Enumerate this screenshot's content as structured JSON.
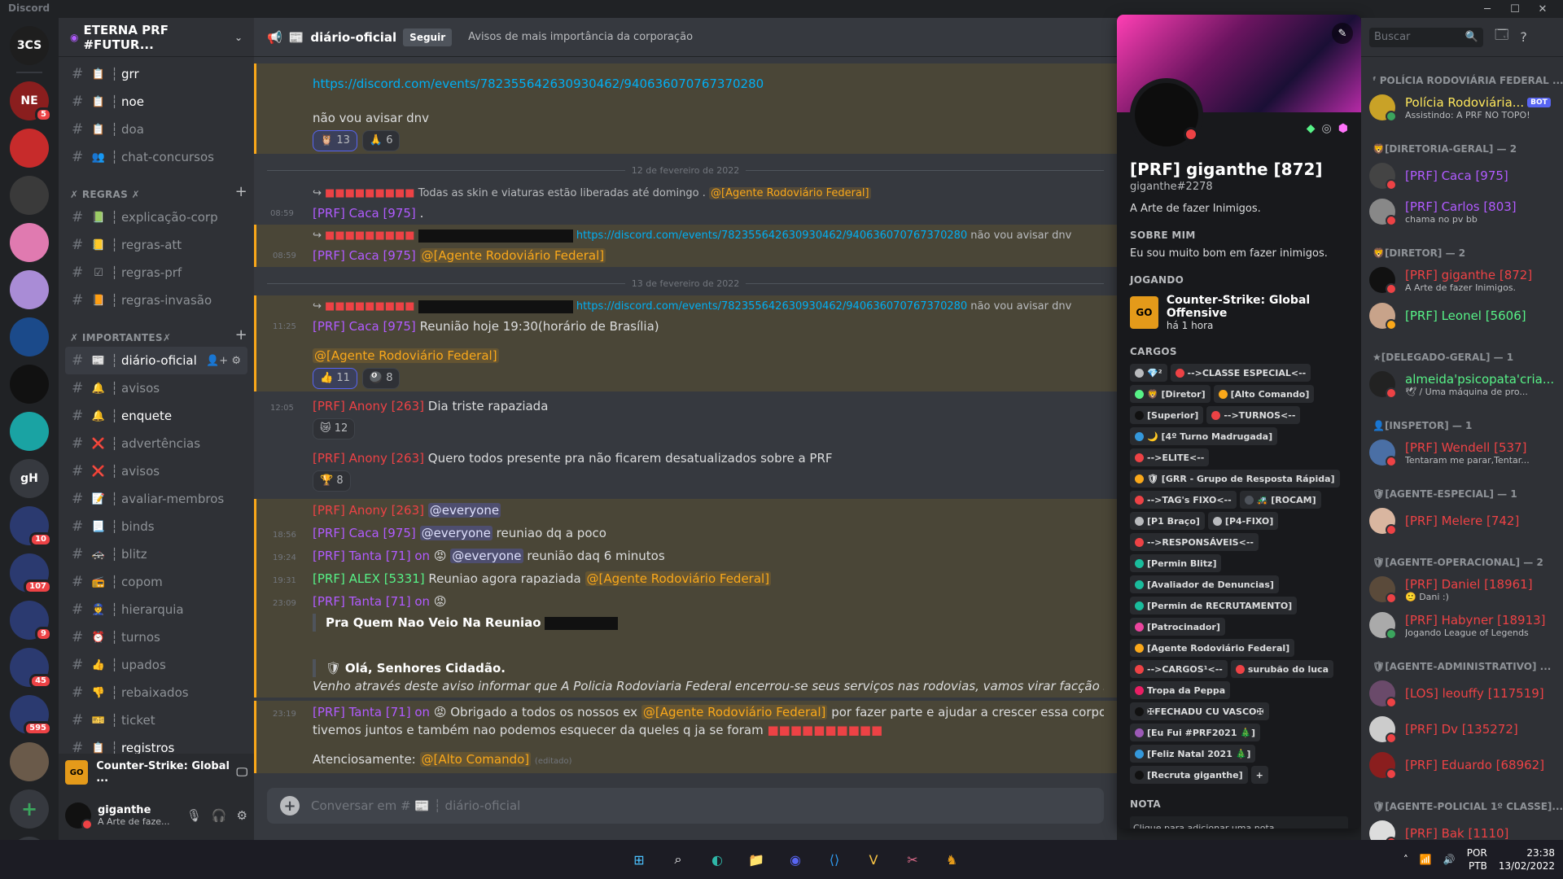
{
  "app": {
    "title": "Discord"
  },
  "server": {
    "name": "ETERNA PRF #FUTUR...",
    "header_icon": "chevron-down-icon"
  },
  "guilds": [
    {
      "label": "3CS",
      "color": "#1e1e1e",
      "badge": ""
    },
    {
      "label": "NE",
      "color": "#8a1e1e",
      "badge": "5"
    },
    {
      "label": "",
      "color": "#c72b2b",
      "badge": ""
    },
    {
      "label": "",
      "color": "#3a3a3a",
      "badge": ""
    },
    {
      "label": "",
      "color": "#e07ab0",
      "badge": ""
    },
    {
      "label": "",
      "color": "#a98cd6",
      "badge": ""
    },
    {
      "label": "",
      "color": "#1b4a8a",
      "badge": ""
    },
    {
      "label": "",
      "color": "#111",
      "badge": ""
    },
    {
      "label": "",
      "color": "#1aa3a3",
      "badge": ""
    },
    {
      "label": "gH",
      "color": "#36393f",
      "badge": ""
    },
    {
      "label": "",
      "color": "#2b3a70",
      "badge": "10"
    },
    {
      "label": "",
      "color": "#2b3a70",
      "badge": "107"
    },
    {
      "label": "",
      "color": "#2b3a70",
      "badge": "9"
    },
    {
      "label": "",
      "color": "#2b3a70",
      "badge": "45"
    },
    {
      "label": "",
      "color": "#2b3a70",
      "badge": "595"
    },
    {
      "label": "",
      "color": "#6a5a4a",
      "badge": ""
    }
  ],
  "channels": {
    "top": [
      {
        "name": "grr",
        "icon": "📋",
        "unread": true
      },
      {
        "name": "noe",
        "icon": "📋",
        "unread": true
      },
      {
        "name": "doa",
        "icon": "📋",
        "unread": false
      },
      {
        "name": "chat-concursos",
        "icon": "👥",
        "unread": false
      }
    ],
    "cat_regras": "✗ REGRAS ✗",
    "regras": [
      {
        "name": "explicação-corp",
        "icon": "📗"
      },
      {
        "name": "regras-att",
        "icon": "📒"
      },
      {
        "name": "regras-prf",
        "icon": "☑"
      },
      {
        "name": "regras-invasão",
        "icon": "📙"
      }
    ],
    "cat_importantes": "✗ IMPORTANTES✗",
    "importantes": [
      {
        "name": "diário-oficial",
        "icon": "📰",
        "active": true,
        "unread": false
      },
      {
        "name": "avisos",
        "icon": "🔔",
        "active": false,
        "unread": false
      },
      {
        "name": "enquete",
        "icon": "🔔",
        "active": false,
        "unread": true
      },
      {
        "name": "advertências",
        "icon": "❌",
        "active": false,
        "unread": false
      },
      {
        "name": "avisos",
        "icon": "❌",
        "active": false,
        "unread": false
      },
      {
        "name": "avaliar-membros",
        "icon": "📝",
        "active": false,
        "unread": false
      },
      {
        "name": "binds",
        "icon": "📃",
        "active": false,
        "unread": false
      },
      {
        "name": "blitz",
        "icon": "🚓",
        "active": false,
        "unread": false
      },
      {
        "name": "copom",
        "icon": "📻",
        "active": false,
        "unread": false
      },
      {
        "name": "hierarquia",
        "icon": "👮",
        "active": false,
        "unread": false
      },
      {
        "name": "turnos",
        "icon": "⏰",
        "active": false,
        "unread": false
      },
      {
        "name": "upados",
        "icon": "👍",
        "active": false,
        "unread": false
      },
      {
        "name": "rebaixados",
        "icon": "👎",
        "active": false,
        "unread": false
      },
      {
        "name": "ticket",
        "icon": "🎫",
        "active": false,
        "unread": false
      },
      {
        "name": "registros",
        "icon": "📋",
        "active": false,
        "unread": true
      }
    ]
  },
  "activity": {
    "game": "Counter-Strike: Global ...",
    "icon_text": "GO"
  },
  "user": {
    "name": "giganthe",
    "status": "A Arte de faze..."
  },
  "chat": {
    "channel": "diário-oficial",
    "follow": "Seguir",
    "topic": "Avisos de mais importância da corporação",
    "placeholder": "Conversar em # 📰 ┆ diário-oficial",
    "link": "https://discord.com/events/782355642630930462/940636070767370280",
    "msg_dnv": "não vou avisar dnv",
    "react_a": "13",
    "react_b": "6",
    "date1": "12 de fevereiro de 2022",
    "date2": "13 de fevereiro de 2022",
    "reply1_text": "Todas as skin e viaturas estão liberadas até domingo .",
    "mention_agente": "@[Agente Rodoviário Federal]",
    "ts1": "08:59",
    "caca": "[PRF] Caca [975]",
    "dot": ".",
    "ts2": "08:59",
    "ts3": "11:25",
    "reuniao": "Reunião hoje 19:30(horário de Brasília)",
    "react_c": "11",
    "react_d": "8",
    "ts4": "12:05",
    "anony": "[PRF] Anony [263]",
    "triste": "Dia triste rapaziada",
    "react_e": "12",
    "todos": "Quero todos presente pra não ficarem desatualizados sobre a PRF",
    "react_f": "8",
    "everyone": "@everyone",
    "ts5": "18:56",
    "reuniao_dq": "reuniao dq a poco",
    "ts6": "19:24",
    "tanta": "[PRF] Tanta [71] on",
    "reuniao_6": "reunião daq 6 minutos",
    "ts7": "19:31",
    "alex": "[PRF] ALEX [5331]",
    "reuniao_agora": "Reuniao agora rapaziada",
    "ts8": "23:09",
    "pra_quem": "Pra Quem Nao Veio Na Reuniao",
    "ola": "Olá, Senhores Cidadão.",
    "venho": "Venho através deste aviso informar que A Policia Rodoviaria Federal encerrou-se seus serviços nas rodovias, vamos virar facção só aguardar os próx",
    "ts9": "23:19",
    "obrigado": "Obrigado a todos os nossos ex",
    "obrigado2": "por fazer parte e ajudar a crescer essa corporação, obrigado a t",
    "tivemos": "tivemos juntos e também nao podemos esquecer da queles q ja se foram",
    "atenciosamente": "Atenciosamente:",
    "alto_comando": "@[Alto Comando]",
    "editado": "(editado)"
  },
  "profile": {
    "name": "[PRF] giganthe [872]",
    "tag": "giganthe#2278",
    "status": "A Arte de fazer Inimigos.",
    "about_title": "SOBRE MIM",
    "about": "Eu sou muito bom em fazer inimigos.",
    "playing_title": "JOGANDO",
    "game": "Counter-Strike: Global Offensive",
    "game_time": "há 1 hora",
    "roles_title": "CARGOS",
    "roles": [
      {
        "name": "💎²",
        "color": "#b9bbbe"
      },
      {
        "name": "-->CLASSE ESPECIAL<--",
        "color": "#ed4245"
      },
      {
        "name": "🦁 [Diretor]",
        "color": "#57f287"
      },
      {
        "name": "[Alto Comando]",
        "color": "#faa81a"
      },
      {
        "name": "[Superior]",
        "color": "#111"
      },
      {
        "name": "-->TURNOS<--",
        "color": "#ed4245"
      },
      {
        "name": "🌙 [4º Turno Madrugada]",
        "color": "#3498db"
      },
      {
        "name": "-->ELITE<--",
        "color": "#ed4245"
      },
      {
        "name": "🛡 [GRR - Grupo de Resposta Rápida]",
        "color": "#faa81a"
      },
      {
        "name": "-->TAG's FIXO<--",
        "color": "#ed4245"
      },
      {
        "name": "🚜 [ROCAM]",
        "color": "#4f545c"
      },
      {
        "name": "[P1 Braço]",
        "color": "#b9bbbe"
      },
      {
        "name": "[P4-FIXO]",
        "color": "#b9bbbe"
      },
      {
        "name": "-->RESPONSÁVEIS<--",
        "color": "#ed4245"
      },
      {
        "name": "[Permin Blitz]",
        "color": "#1abc9c"
      },
      {
        "name": "[Avaliador de Denuncias]",
        "color": "#1abc9c"
      },
      {
        "name": "[Permin de RECRUTAMENTO]",
        "color": "#1abc9c"
      },
      {
        "name": "[Patrocinador]",
        "color": "#eb459e"
      },
      {
        "name": "[Agente Rodoviário Federal]",
        "color": "#faa81a"
      },
      {
        "name": "-->CARGOS¹<--",
        "color": "#ed4245"
      },
      {
        "name": "surubão do luca",
        "color": "#ed4245"
      },
      {
        "name": "Tropa da Peppa",
        "color": "#e91e63"
      },
      {
        "name": "✠FECHADU CU VASCO✠",
        "color": "#111"
      },
      {
        "name": "[Eu Fui #PRF2021 🎄]",
        "color": "#9b59b6"
      },
      {
        "name": "[Feliz Natal 2021 🎄]",
        "color": "#3498db"
      },
      {
        "name": "[Recruta giganthe]",
        "color": "#111"
      }
    ],
    "add_role": "+",
    "note_title": "NOTA",
    "note_placeholder": "Clique para adicionar uma nota"
  },
  "members": {
    "search_placeholder": "Buscar",
    "groups": [
      {
        "title": "ᶠ POLÍCIA RODOVIÁRIA FEDERAL ...",
        "items": [
          {
            "name": "Polícia Rodoviária...",
            "sub": "Assistindo: A PRF NO TOPO!",
            "color": "#fee75c",
            "bot": "BOT",
            "status": "#3ba55d",
            "av": "#c9a227"
          }
        ]
      },
      {
        "title": "🦁[DIRETORIA-GERAL] — 2",
        "items": [
          {
            "name": "[PRF] Caca [975]",
            "sub": "",
            "color": "#b15bff",
            "bot": "",
            "status": "#ed4245",
            "av": "#444"
          },
          {
            "name": "[PRF] Carlos [803]",
            "sub": "chama no pv bb",
            "color": "#b15bff",
            "bot": "",
            "status": "#ed4245",
            "av": "#888"
          }
        ]
      },
      {
        "title": "🦁[DIRETOR] — 2",
        "items": [
          {
            "name": "[PRF] giganthe [872]",
            "sub": "A Arte de fazer Inimigos.",
            "color": "#ed4245",
            "bot": "",
            "status": "#ed4245",
            "av": "#111"
          },
          {
            "name": "[PRF] Leonel [5606]",
            "sub": "",
            "color": "#57f287",
            "bot": "",
            "status": "#faa81a",
            "av": "#c8a38a"
          }
        ]
      },
      {
        "title": "★[DELEGADO-GERAL] — 1",
        "items": [
          {
            "name": "almeida'psicopata'cria...",
            "sub": "🕊 / Uma máquina de pro...",
            "color": "#57f287",
            "bot": "",
            "status": "#ed4245",
            "av": "#222"
          }
        ]
      },
      {
        "title": "👤[INSPETOR] — 1",
        "items": [
          {
            "name": "[PRF] Wendell [537]",
            "sub": "Tentaram me parar,Tentar...",
            "color": "#ed4245",
            "bot": "",
            "status": "#ed4245",
            "av": "#4a6fa5"
          }
        ]
      },
      {
        "title": "🛡[AGENTE-ESPECIAL] — 1",
        "items": [
          {
            "name": "[PRF] Melere [742]",
            "sub": "",
            "color": "#ed4245",
            "bot": "",
            "status": "#ed4245",
            "av": "#d9b6a0"
          }
        ]
      },
      {
        "title": "🛡[AGENTE-OPERACIONAL] — 2",
        "items": [
          {
            "name": "[PRF] Daniel [18961]",
            "sub": "🙂 Dani :)",
            "color": "#ed4245",
            "bot": "",
            "status": "#ed4245",
            "av": "#5a4a3a"
          },
          {
            "name": "[PRF] Habyner [18913]",
            "sub": "Jogando League of Legends",
            "color": "#ed4245",
            "bot": "",
            "status": "#3ba55d",
            "av": "#aaa"
          }
        ]
      },
      {
        "title": "🛡[AGENTE-ADMINISTRATIVO] ...",
        "items": [
          {
            "name": "[LOS] leouffy [117519]",
            "sub": "",
            "color": "#ed4245",
            "bot": "",
            "status": "#ed4245",
            "av": "#6a4a6a"
          },
          {
            "name": "[PRF] Dv [135272]",
            "sub": "",
            "color": "#ed4245",
            "bot": "",
            "status": "#ed4245",
            "av": "#ccc"
          },
          {
            "name": "[PRF] Eduardo [68962]",
            "sub": "",
            "color": "#ed4245",
            "bot": "",
            "status": "#ed4245",
            "av": "#8a1e1e"
          }
        ]
      },
      {
        "title": "🛡[AGENTE-POLICIAL 1º CLASSE]...",
        "items": [
          {
            "name": "[PRF] Bak [1110]",
            "sub": "",
            "color": "#ed4245",
            "bot": "",
            "status": "#ed4245",
            "av": "#ddd"
          }
        ]
      }
    ]
  },
  "taskbar": {
    "icons": [
      "windows-icon",
      "search-icon",
      "edge-icon",
      "folder-icon",
      "discord-icon",
      "vscode-icon",
      "v-app-icon",
      "snip-icon",
      "game-icon"
    ],
    "lang1": "POR",
    "lang2": "PTB",
    "time": "23:38",
    "date": "13/02/2022"
  }
}
